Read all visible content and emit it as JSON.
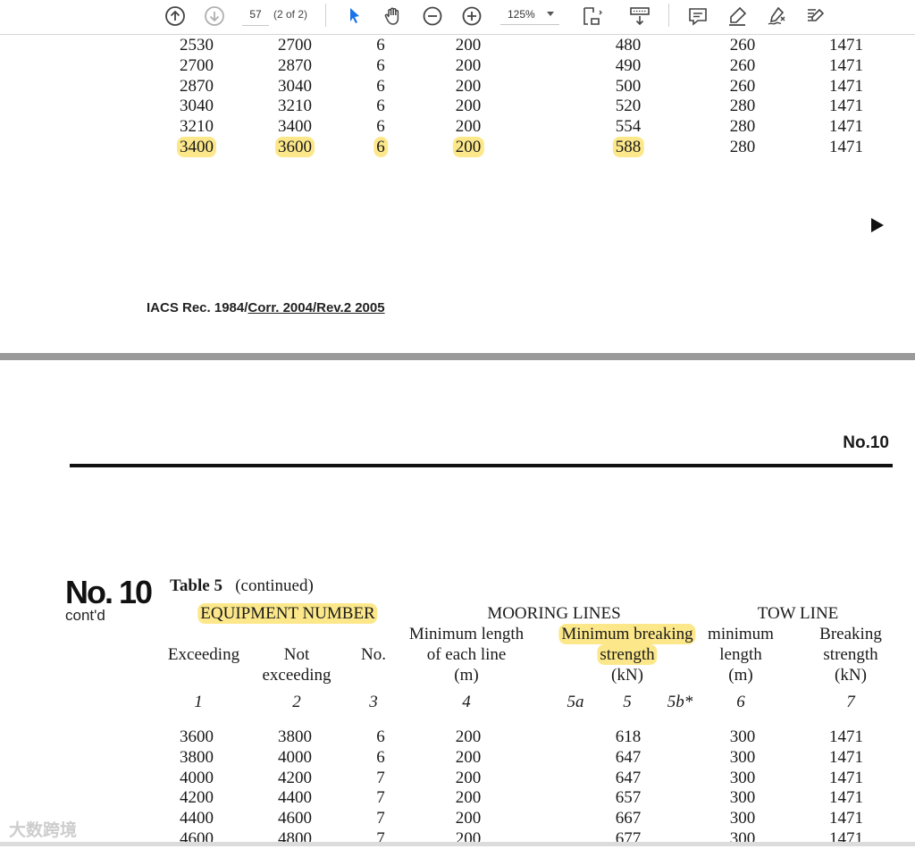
{
  "toolbar": {
    "page_number": "57",
    "page_count": "(2 of 2)",
    "zoom": "125%"
  },
  "icons": [
    "prev-page-icon",
    "next-page-icon",
    "select-pointer-icon",
    "hand-icon",
    "zoom-out-icon",
    "zoom-in-icon",
    "page-fit-icon",
    "scroll-mode-icon",
    "comment-icon",
    "highlight-pen-icon",
    "draw-sign-icon",
    "edit-pdf-icon"
  ],
  "page1": {
    "rows": [
      [
        "2530",
        "2700",
        "6",
        "200",
        "480",
        "260",
        "1471"
      ],
      [
        "2700",
        "2870",
        "6",
        "200",
        "490",
        "260",
        "1471"
      ],
      [
        "2870",
        "3040",
        "6",
        "200",
        "500",
        "260",
        "1471"
      ],
      [
        "3040",
        "3210",
        "6",
        "200",
        "520",
        "280",
        "1471"
      ],
      [
        "3210",
        "3400",
        "6",
        "200",
        "554",
        "280",
        "1471"
      ],
      [
        "3400",
        "3600",
        "6",
        "200",
        "588",
        "280",
        "1471"
      ]
    ],
    "footer_plain": "IACS Rec. 1984/",
    "footer_underlined": "Corr. 2004/Rev.2 2005"
  },
  "page2": {
    "doc_no": "No.10",
    "big_no": "No. 10",
    "contd": "cont'd",
    "table_label": "Table 5",
    "table_suffix": "(continued)",
    "headers": {
      "equipment_number": "EQUIPMENT NUMBER",
      "mooring_lines": "MOORING LINES",
      "tow_line": "TOW LINE",
      "exceeding": "Exceeding",
      "not": "Not",
      "exceeding2": "exceeding",
      "no": "No.",
      "min_length_1": "Minimum length",
      "min_length_2": "of each line",
      "min_length_3": "(m)",
      "mbs_1": "Minimum breaking",
      "mbs_2": "strength",
      "mbs_3": "(kN)",
      "tow_min_1": "minimum",
      "tow_min_2": "length",
      "tow_min_3": "(m)",
      "tow_bs_1": "Breaking",
      "tow_bs_2": "strength",
      "tow_bs_3": "(kN)"
    },
    "col_numbers": [
      "1",
      "2",
      "3",
      "4",
      "5a",
      "5",
      "5b*",
      "6",
      "7"
    ],
    "rows": [
      [
        "3600",
        "3800",
        "6",
        "200",
        "618",
        "300",
        "1471"
      ],
      [
        "3800",
        "4000",
        "6",
        "200",
        "647",
        "300",
        "1471"
      ],
      [
        "4000",
        "4200",
        "7",
        "200",
        "647",
        "300",
        "1471"
      ],
      [
        "4200",
        "4400",
        "7",
        "200",
        "657",
        "300",
        "1471"
      ],
      [
        "4400",
        "4600",
        "7",
        "200",
        "667",
        "300",
        "1471"
      ],
      [
        "4600",
        "4800",
        "7",
        "200",
        "677",
        "300",
        "1471"
      ]
    ]
  },
  "watermark": "大数跨境",
  "colors": {
    "highlight": "#fce88a",
    "accent_blue": "#1a73e8"
  }
}
